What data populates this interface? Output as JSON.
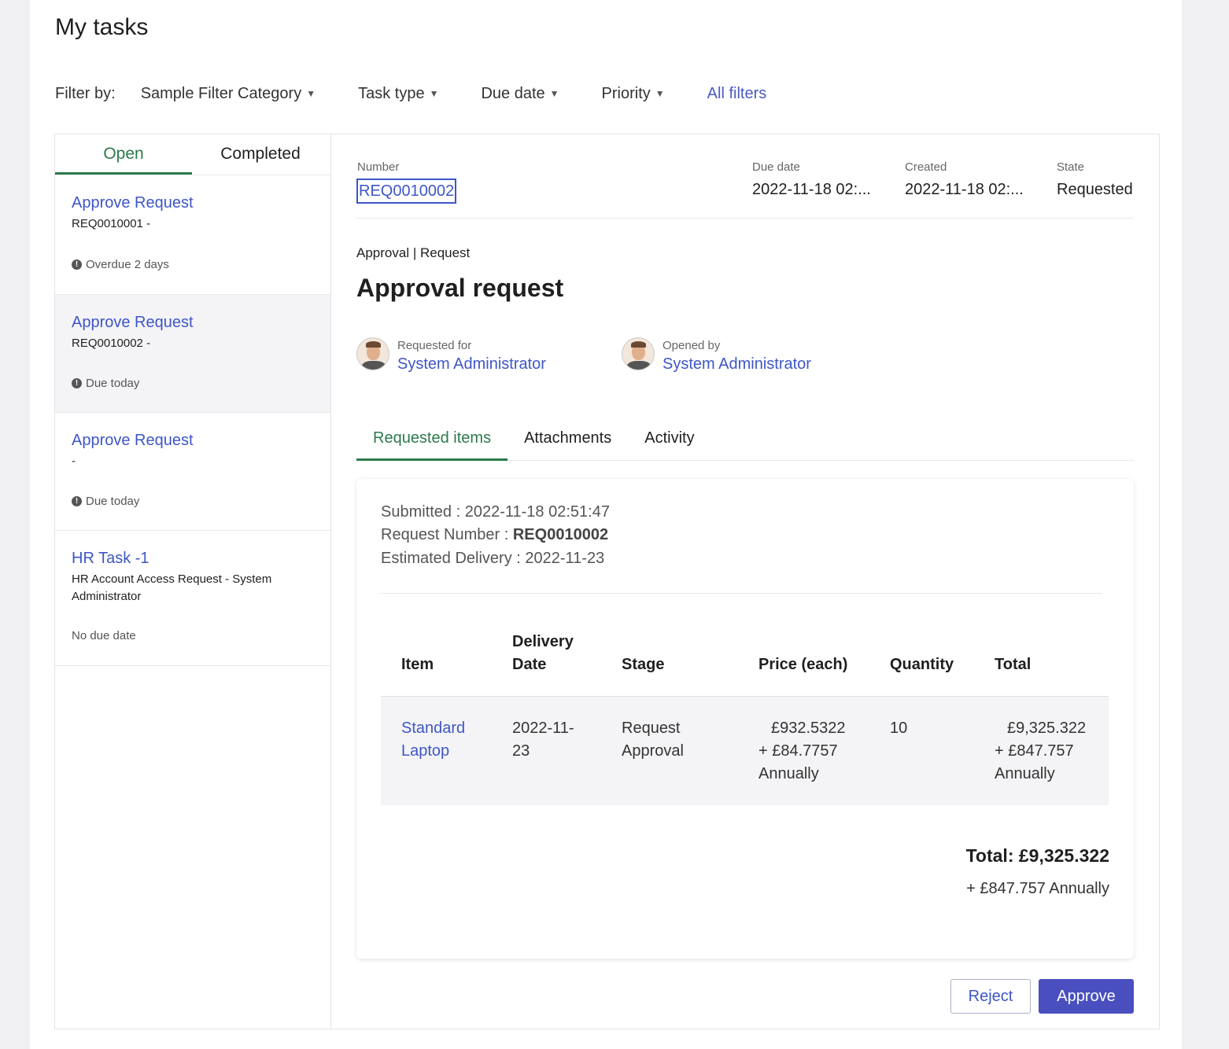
{
  "page": {
    "title": "My tasks"
  },
  "filters": {
    "label": "Filter by:",
    "dropdowns": [
      "Sample Filter Category",
      "Task type",
      "Due date",
      "Priority"
    ],
    "all_filters": "All filters"
  },
  "list_tabs": {
    "open": "Open",
    "completed": "Completed",
    "active": "Open"
  },
  "tasks": [
    {
      "title": "Approve Request",
      "subtitle": "REQ0010001 -",
      "due": "Overdue 2 days",
      "due_icon": "info-icon",
      "selected": false
    },
    {
      "title": "Approve Request",
      "subtitle": "REQ0010002 -",
      "due": "Due today",
      "due_icon": "info-icon",
      "selected": true
    },
    {
      "title": "Approve Request",
      "subtitle": "-",
      "due": "Due today",
      "due_icon": "info-icon",
      "selected": false
    },
    {
      "title": "HR Task -1",
      "subtitle": "HR Account Access Request - System Administrator",
      "due": "No due date",
      "due_icon": "",
      "selected": false
    }
  ],
  "detail": {
    "number_label": "Number",
    "number": "REQ0010002",
    "due_date_label": "Due date",
    "due_date": "2022-11-18 02:...",
    "created_label": "Created",
    "created": "2022-11-18 02:...",
    "state_label": "State",
    "state": "Requested",
    "breadcrumb": "Approval | Request",
    "title": "Approval request",
    "requested_for_label": "Requested for",
    "requested_for": "System Administrator",
    "opened_by_label": "Opened by",
    "opened_by": "System Administrator",
    "tabs": [
      "Requested items",
      "Attachments",
      "Activity"
    ],
    "active_tab": "Requested items"
  },
  "summary": {
    "submitted": "Submitted : 2022-11-18 02:51:47",
    "request_number_label": "Request Number : ",
    "request_number": "REQ0010002",
    "estimated_delivery": "Estimated Delivery : 2022-11-23"
  },
  "table": {
    "headers": {
      "item": "Item",
      "delivery_1": "Delivery",
      "delivery_2": "Date",
      "stage": "Stage",
      "price": "Price (each)",
      "quantity": "Quantity",
      "total": "Total"
    },
    "rows": [
      {
        "item_1": "Standard",
        "item_2": "Laptop",
        "date_1": "2022-11-",
        "date_2": "23",
        "stage_1": "Request",
        "stage_2": "Approval",
        "price_1": "£932.5322",
        "price_2": "+ £84.7757",
        "price_3": "Annually",
        "quantity": "10",
        "total_1": "£9,325.322",
        "total_2": "+ £847.757",
        "total_3": "Annually"
      }
    ]
  },
  "totals": {
    "total": "Total: £9,325.322",
    "recurring": "+ £847.757 Annually"
  },
  "actions": {
    "reject": "Reject",
    "approve": "Approve"
  },
  "colors": {
    "accent": "#3e56c7",
    "tab_active": "#2c7a4b",
    "approve_bg": "#4a4fc0"
  }
}
